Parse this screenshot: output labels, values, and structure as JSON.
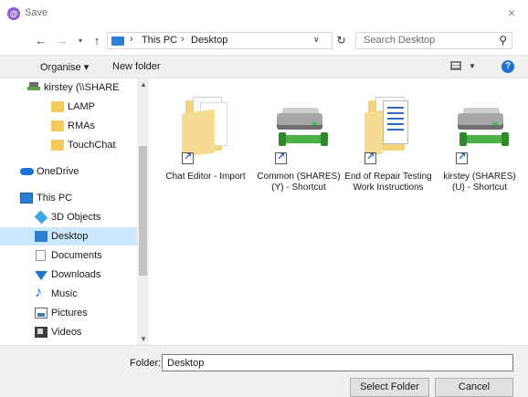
{
  "window": {
    "title": "Save",
    "close_glyph": "×"
  },
  "address_bar": {
    "crumbs": [
      "This PC",
      "Desktop"
    ],
    "separator": "›",
    "search_placeholder": "Search Desktop"
  },
  "toolbar": {
    "organise_label": "Organise ▾",
    "new_folder_label": "New folder",
    "help_glyph": "?"
  },
  "nav_pane": {
    "items": [
      {
        "label": "kirstey (\\\\SHARE",
        "icon": "network-drive-icon"
      },
      {
        "label": "LAMP",
        "icon": "folder-icon"
      },
      {
        "label": "RMAs",
        "icon": "folder-icon"
      },
      {
        "label": "TouchChat",
        "icon": "folder-icon"
      },
      {
        "label": "OneDrive",
        "icon": "onedrive-icon"
      },
      {
        "label": "This PC",
        "icon": "pc-icon"
      },
      {
        "label": "3D Objects",
        "icon": "3d-objects-icon"
      },
      {
        "label": "Desktop",
        "icon": "desktop-icon",
        "selected": true
      },
      {
        "label": "Documents",
        "icon": "documents-icon"
      },
      {
        "label": "Downloads",
        "icon": "downloads-icon"
      },
      {
        "label": "Music",
        "icon": "music-icon"
      },
      {
        "label": "Pictures",
        "icon": "pictures-icon"
      },
      {
        "label": "Videos",
        "icon": "videos-icon"
      }
    ]
  },
  "files": [
    {
      "name": "Chat Editor - Import",
      "type": "folder-shortcut"
    },
    {
      "name": "Common (SHARES) (Y) - Shortcut",
      "type": "drive-shortcut"
    },
    {
      "name": "End of Repair Testing Work Instructions",
      "type": "document-folder-shortcut"
    },
    {
      "name": "kirstey (SHARES) (U) - Shortcut",
      "type": "drive-shortcut"
    }
  ],
  "footer": {
    "folder_label": "Folder:",
    "folder_value": "Desktop",
    "select_folder_label": "Select Folder",
    "cancel_label": "Cancel"
  }
}
